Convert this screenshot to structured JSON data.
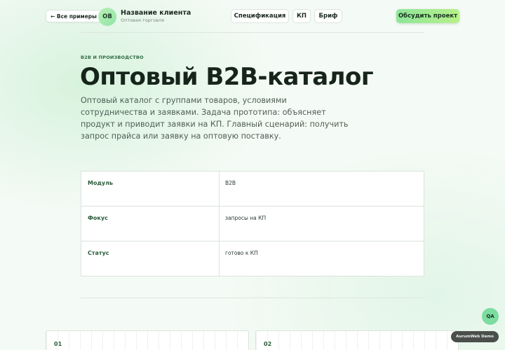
{
  "header": {
    "back_label": "← Все примеры",
    "avatar_initials": "OB",
    "client_name": "Название клиента",
    "client_subtitle": "Оптовая торговля",
    "nav": [
      {
        "label": "Спецификация"
      },
      {
        "label": "КП"
      },
      {
        "label": "Бриф"
      }
    ],
    "cta_label": "Обсудить проект"
  },
  "hero": {
    "eyebrow": "B2B И ПРОИЗВОДСТВО",
    "title": "Оптовый B2B-каталог",
    "description": "Оптовый каталог с группами товаров, условиями сотрудничества и заявками. Задача прототипа: объясняет продукт и приводит заявки на КП. Главный сценарий: получить запрос прайса или заявку на оптовую поставку."
  },
  "info": {
    "rows": [
      {
        "key": "Модуль",
        "value": "B2B"
      },
      {
        "key": "Фокус",
        "value": "запросы на КП"
      },
      {
        "key": "Статус",
        "value": "готово к КП"
      }
    ]
  },
  "cards": [
    {
      "number": "01"
    },
    {
      "number": "02"
    }
  ],
  "widgets": {
    "qa_label": "QA",
    "demo_label": "AurumWeb Demo"
  },
  "colors": {
    "accent": "#8fe59a",
    "background": "#f4faf5",
    "text": "#16241b"
  }
}
